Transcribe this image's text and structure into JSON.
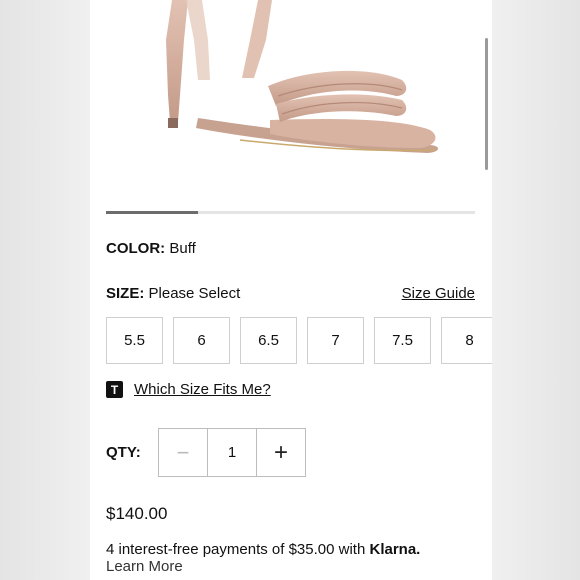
{
  "product": {
    "image_alt": "nude patent leather high heel sandal",
    "image_carousel_progress": 0.25
  },
  "color": {
    "label": "COLOR:",
    "value": "Buff"
  },
  "size": {
    "label": "SIZE:",
    "value": "Please Select",
    "guide_link": "Size Guide",
    "options": [
      "5.5",
      "6",
      "6.5",
      "7",
      "7.5",
      "8"
    ]
  },
  "fit": {
    "icon": "T",
    "link": "Which Size Fits Me?"
  },
  "quantity": {
    "label": "QTY:",
    "value": "1",
    "minus": "−",
    "plus": "+"
  },
  "price": "$140.00",
  "klarna": {
    "text": "4 interest-free payments of $35.00 with",
    "brand": "Klarna.",
    "learn_more": "Learn More"
  },
  "colors": {
    "accent": "#111111",
    "progress": "#6c6c6c",
    "shoe": "#d9b5a5"
  }
}
